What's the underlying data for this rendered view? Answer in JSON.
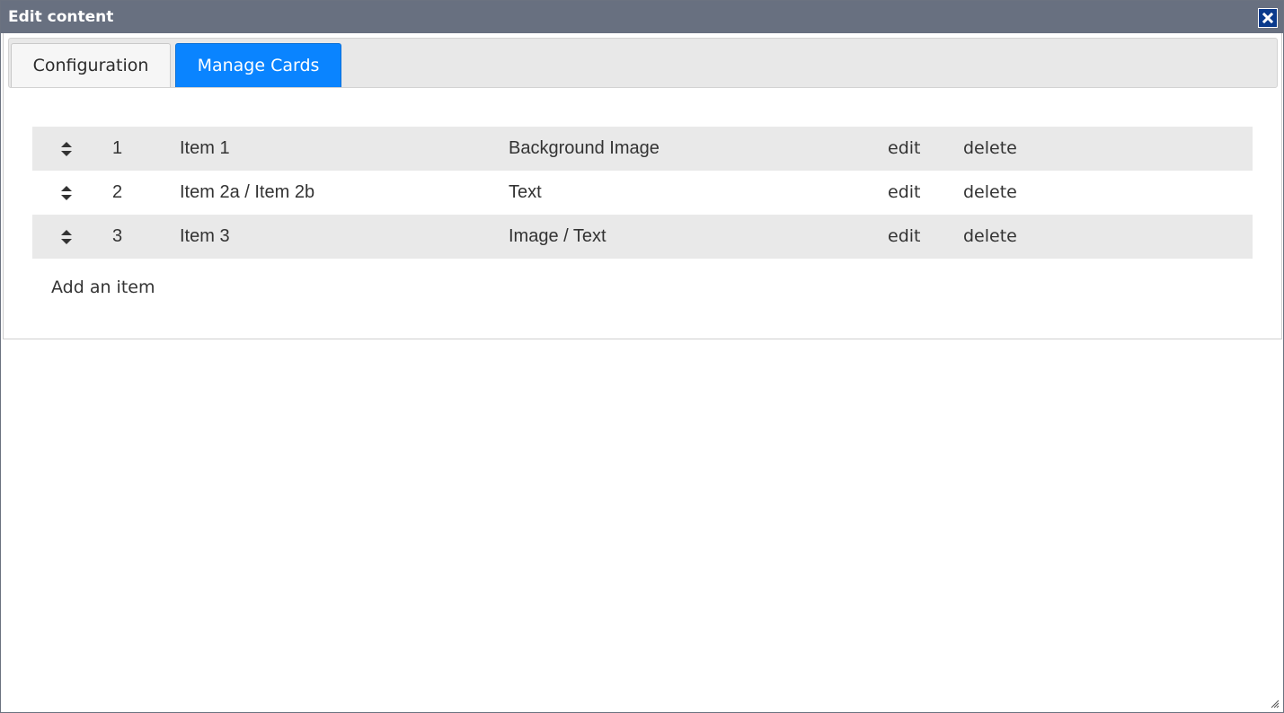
{
  "dialog": {
    "title": "Edit content",
    "close_icon": "close-icon"
  },
  "tabs": [
    {
      "label": "Configuration",
      "active": false
    },
    {
      "label": "Manage Cards",
      "active": true
    }
  ],
  "cards": [
    {
      "number": "1",
      "name": "Item 1",
      "type": "Background Image",
      "edit_label": "edit",
      "delete_label": "delete"
    },
    {
      "number": "2",
      "name": "Item 2a / Item 2b",
      "type": "Text",
      "edit_label": "edit",
      "delete_label": "delete"
    },
    {
      "number": "3",
      "name": "Item 3",
      "type": "Image / Text",
      "edit_label": "edit",
      "delete_label": "delete"
    }
  ],
  "add_item_label": "Add an item",
  "colors": {
    "titlebar": "#687080",
    "active_tab": "#0a84ff",
    "close_button": "#0a3a8c",
    "row_shade": "#e9e9e9"
  }
}
